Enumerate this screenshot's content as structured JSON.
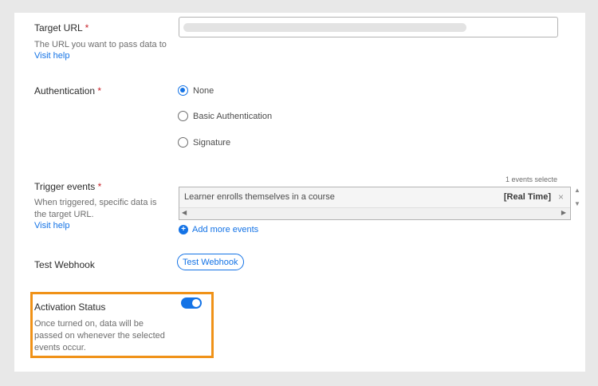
{
  "target_url": {
    "label": "Target URL",
    "required_mark": "*",
    "description": "The URL you want to pass data to",
    "help_link": "Visit help"
  },
  "authentication": {
    "label": "Authentication",
    "required_mark": "*",
    "options": [
      "None",
      "Basic Authentication",
      "Signature"
    ],
    "selected": "None"
  },
  "trigger_events": {
    "label": "Trigger events",
    "required_mark": "*",
    "description": "When triggered, specific data is the target URL.",
    "help_link": "Visit help",
    "selected_count_text": "1 events selecte",
    "events": [
      {
        "name": "Learner enrolls themselves in a course",
        "tag": "[Real Time]"
      }
    ],
    "add_more_label": "Add more events"
  },
  "test_webhook": {
    "label": "Test Webhook",
    "button_label": "Test Webhook"
  },
  "activation_status": {
    "label": "Activation Status",
    "description": "Once turned on, data will be passed on whenever the selected events occur.",
    "enabled": true
  },
  "colors": {
    "accent": "#1473e6",
    "highlight": "#f09218",
    "required": "#c9252c"
  }
}
